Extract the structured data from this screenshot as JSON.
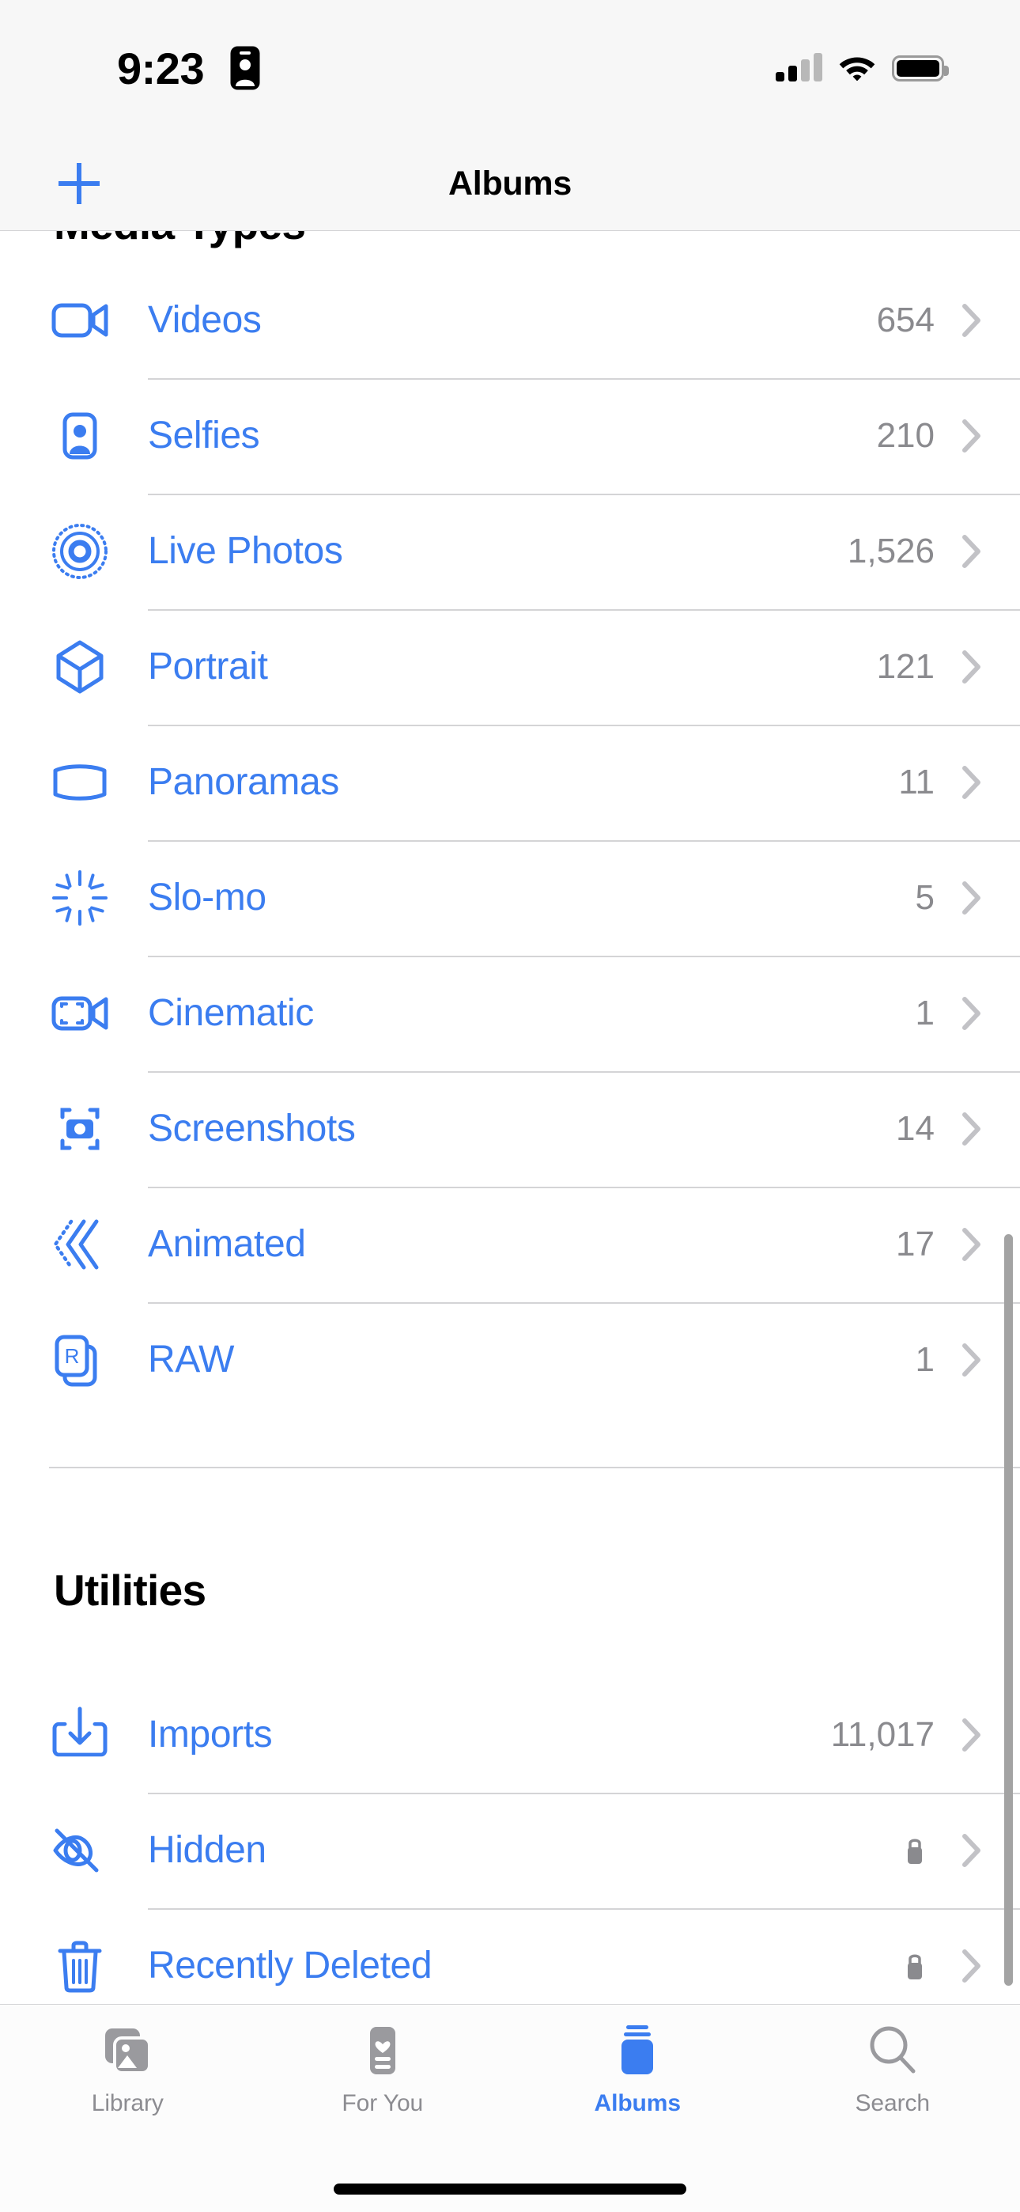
{
  "status_bar": {
    "time": "9:23",
    "face_id_icon": "contact-card-icon",
    "cellular_icon": "cellular-signal-icon",
    "cellular_bars_filled": 2,
    "cellular_bars_total": 4,
    "wifi_icon": "wifi-icon",
    "battery_icon": "battery-full-icon",
    "battery_level_pct": 100
  },
  "nav_bar": {
    "add_label": "+",
    "add_icon": "plus-icon",
    "title": "Albums"
  },
  "colors": {
    "accent_blue": "#3B7DF0",
    "count_gray": "#8A8A8E",
    "chevron_gray": "#C2C2C6",
    "separator": "#D4D4D6",
    "tab_inactive": "#8C8C91",
    "background": "#FFFFFF",
    "bar_background": "#F7F7F7"
  },
  "sections": [
    {
      "title": "Media Types",
      "clipped": true,
      "rows": [
        {
          "label": "Videos",
          "count": "654",
          "icon": "video-camera-icon",
          "lock": false
        },
        {
          "label": "Selfies",
          "count": "210",
          "icon": "person-in-frame-icon",
          "lock": false
        },
        {
          "label": "Live Photos",
          "count": "1,526",
          "icon": "live-photo-icon",
          "lock": false
        },
        {
          "label": "Portrait",
          "count": "121",
          "icon": "cube-icon",
          "lock": false
        },
        {
          "label": "Panoramas",
          "count": "11",
          "icon": "panorama-icon",
          "lock": false
        },
        {
          "label": "Slo-mo",
          "count": "5",
          "icon": "slow-motion-icon",
          "lock": false
        },
        {
          "label": "Cinematic",
          "count": "1",
          "icon": "cinematic-video-icon",
          "lock": false
        },
        {
          "label": "Screenshots",
          "count": "14",
          "icon": "screenshot-camera-icon",
          "lock": false
        },
        {
          "label": "Animated",
          "count": "17",
          "icon": "animated-chevrons-icon",
          "lock": false
        },
        {
          "label": "RAW",
          "count": "1",
          "icon": "raw-file-icon",
          "lock": false
        }
      ]
    },
    {
      "title": "Utilities",
      "clipped": false,
      "rows": [
        {
          "label": "Imports",
          "count": "11,017",
          "icon": "import-download-icon",
          "lock": false
        },
        {
          "label": "Hidden",
          "count": "",
          "icon": "eye-slash-icon",
          "lock": true
        },
        {
          "label": "Recently Deleted",
          "count": "",
          "icon": "trash-icon",
          "lock": true
        }
      ]
    }
  ],
  "tab_bar": {
    "tabs": [
      {
        "label": "Library",
        "icon": "photo-stack-icon",
        "active": false
      },
      {
        "label": "For You",
        "icon": "for-you-card-icon",
        "active": false
      },
      {
        "label": "Albums",
        "icon": "albums-book-icon",
        "active": true
      },
      {
        "label": "Search",
        "icon": "magnifier-icon",
        "active": false
      }
    ]
  }
}
